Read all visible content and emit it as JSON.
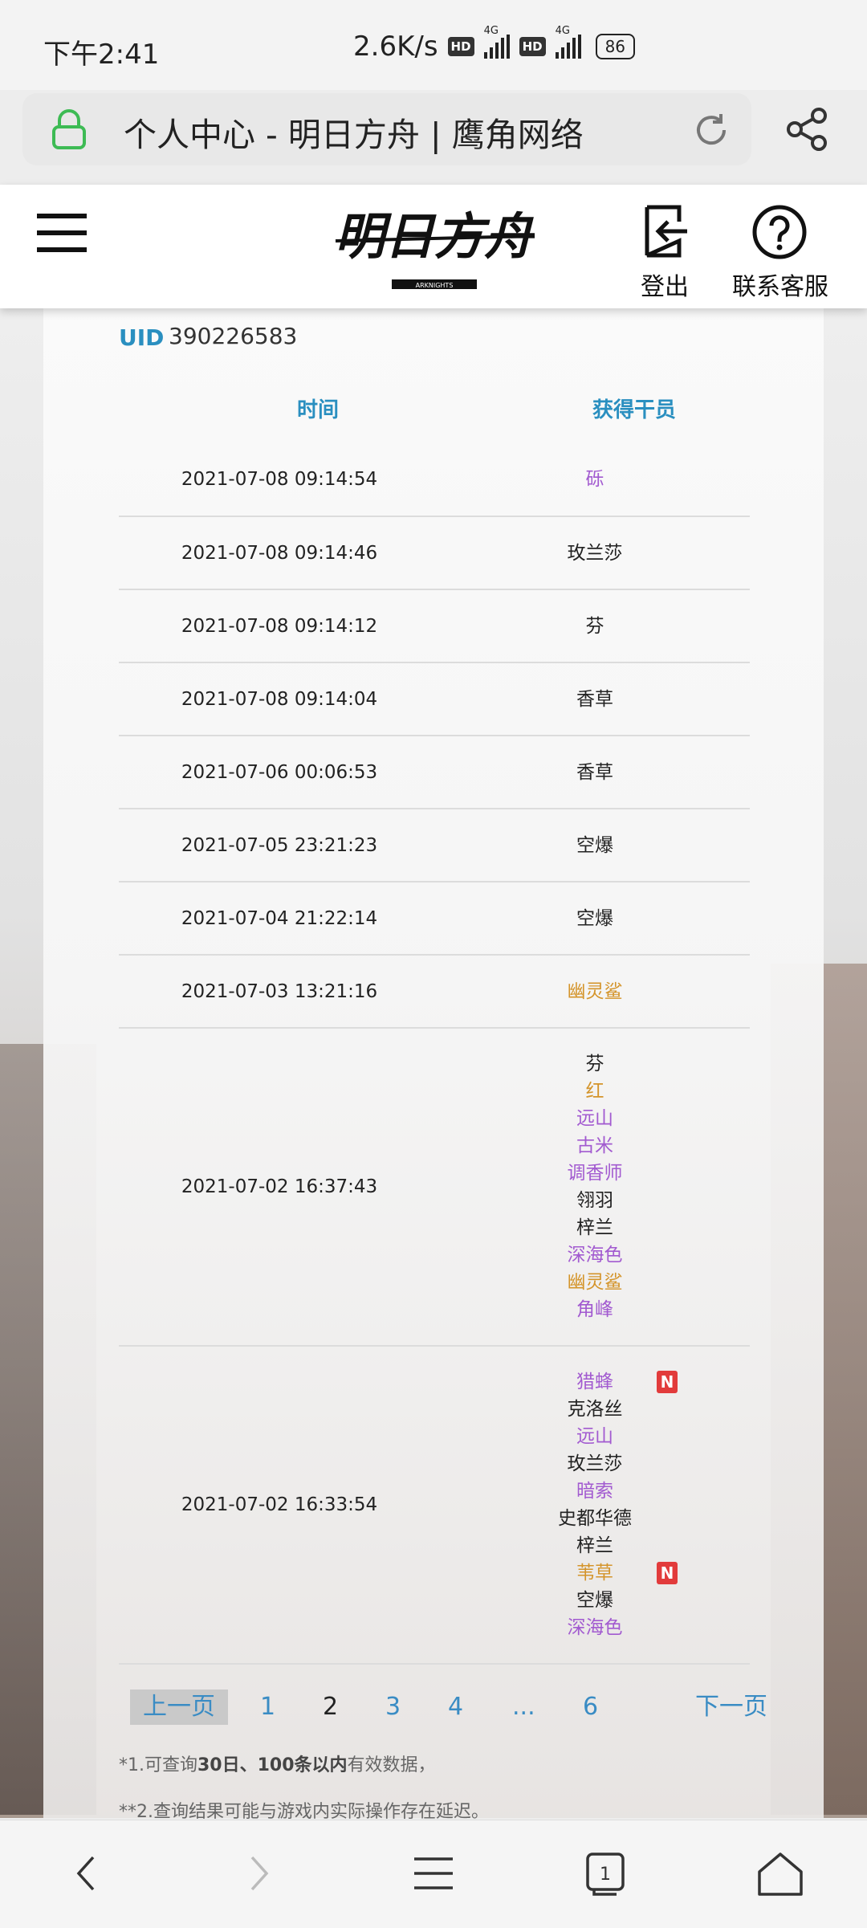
{
  "status_bar": {
    "time": "下午2:41",
    "speed": "2.6K/s",
    "hd": "HD",
    "network": "4G",
    "battery": "86"
  },
  "address_bar": {
    "title": "个人中心 - 明日方舟 | 鹰角网络"
  },
  "header": {
    "logo_text": "明日方舟",
    "logo_sub": "ARKNIGHTS",
    "logout_label": "登出",
    "support_label": "联系客服"
  },
  "profile": {
    "uid_label": "UID",
    "uid_value": "390226583"
  },
  "table": {
    "columns": [
      "时间",
      "获得干员"
    ],
    "rows": [
      {
        "time": "2021-07-08 09:14:54",
        "operators": [
          {
            "name": "砾",
            "rarity": "purple"
          }
        ]
      },
      {
        "time": "2021-07-08 09:14:46",
        "operators": [
          {
            "name": "玫兰莎",
            "rarity": "white"
          }
        ]
      },
      {
        "time": "2021-07-08 09:14:12",
        "operators": [
          {
            "name": "芬",
            "rarity": "white"
          }
        ]
      },
      {
        "time": "2021-07-08 09:14:04",
        "operators": [
          {
            "name": "香草",
            "rarity": "white"
          }
        ]
      },
      {
        "time": "2021-07-06 00:06:53",
        "operators": [
          {
            "name": "香草",
            "rarity": "white"
          }
        ]
      },
      {
        "time": "2021-07-05 23:21:23",
        "operators": [
          {
            "name": "空爆",
            "rarity": "white"
          }
        ]
      },
      {
        "time": "2021-07-04 21:22:14",
        "operators": [
          {
            "name": "空爆",
            "rarity": "white"
          }
        ]
      },
      {
        "time": "2021-07-03 13:21:16",
        "operators": [
          {
            "name": "幽灵鲨",
            "rarity": "gold"
          }
        ]
      },
      {
        "time": "2021-07-02 16:37:43",
        "operators": [
          {
            "name": "芬",
            "rarity": "white"
          },
          {
            "name": "红",
            "rarity": "gold"
          },
          {
            "name": "远山",
            "rarity": "purple"
          },
          {
            "name": "古米",
            "rarity": "purple"
          },
          {
            "name": "调香师",
            "rarity": "purple"
          },
          {
            "name": "翎羽",
            "rarity": "white"
          },
          {
            "name": "梓兰",
            "rarity": "white"
          },
          {
            "name": "深海色",
            "rarity": "purple"
          },
          {
            "name": "幽灵鲨",
            "rarity": "gold"
          },
          {
            "name": "角峰",
            "rarity": "purple"
          }
        ]
      },
      {
        "time": "2021-07-02 16:33:54",
        "operators": [
          {
            "name": "猎蜂",
            "rarity": "purple",
            "new": "N"
          },
          {
            "name": "克洛丝",
            "rarity": "white"
          },
          {
            "name": "远山",
            "rarity": "purple"
          },
          {
            "name": "玫兰莎",
            "rarity": "white"
          },
          {
            "name": "暗索",
            "rarity": "purple"
          },
          {
            "name": "史都华德",
            "rarity": "white"
          },
          {
            "name": "梓兰",
            "rarity": "white"
          },
          {
            "name": "苇草",
            "rarity": "gold",
            "new": "N"
          },
          {
            "name": "空爆",
            "rarity": "white"
          },
          {
            "name": "深海色",
            "rarity": "purple"
          }
        ]
      }
    ]
  },
  "pagination": {
    "prev": "上一页",
    "pages": [
      "1",
      "2",
      "3",
      "4",
      "...",
      "6"
    ],
    "current": "2",
    "next": "下一页"
  },
  "notes": {
    "note1_pre": "*1.可查询",
    "note1_bold": "30日、100条以内",
    "note1_post": "有效数据，",
    "note2": "**2.查询结果可能与游戏内实际操作存在延迟。"
  },
  "colors": {
    "accent_blue": "#2a8fc0",
    "rarity_purple": "#a25ad0",
    "rarity_gold": "#d4942a",
    "new_badge": "#e23b3b"
  }
}
